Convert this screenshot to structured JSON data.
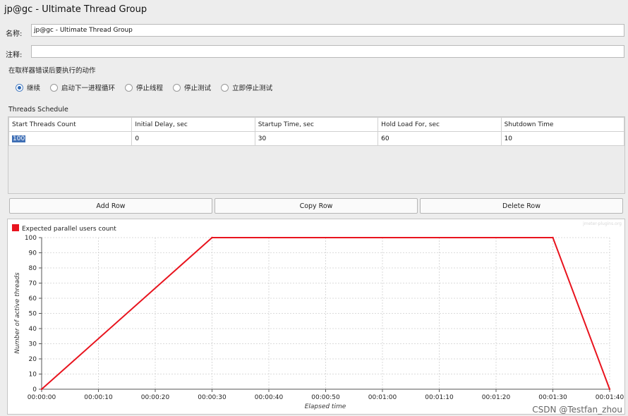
{
  "window": {
    "title": "jp@gc - Ultimate Thread Group"
  },
  "name_field": {
    "label": "名称:",
    "value": "jp@gc - Ultimate Thread Group"
  },
  "comment_field": {
    "label": "注释:",
    "value": ""
  },
  "error_action": {
    "label": "在取样器错误后要执行的动作",
    "options": [
      "继续",
      "启动下一进程循环",
      "停止线程",
      "停止测试",
      "立即停止测试"
    ],
    "selected_index": 0
  },
  "schedule": {
    "label": "Threads Schedule",
    "columns": [
      "Start Threads Count",
      "Initial Delay, sec",
      "Startup Time, sec",
      "Hold Load For, sec",
      "Shutdown Time"
    ],
    "rows": [
      [
        "100",
        "0",
        "30",
        "60",
        "10"
      ]
    ]
  },
  "buttons": {
    "add_row": "Add Row",
    "copy_row": "Copy Row",
    "delete_row": "Delete Row"
  },
  "chart_data": {
    "type": "line",
    "legend": "Expected parallel users count",
    "xlabel": "Elapsed time",
    "ylabel": "Number of active threads",
    "x_ticks": [
      "00:00:00",
      "00:00:10",
      "00:00:20",
      "00:00:30",
      "00:00:40",
      "00:00:50",
      "00:01:00",
      "00:01:10",
      "00:01:20",
      "00:01:30",
      "00:01:40"
    ],
    "y_ticks": [
      0,
      10,
      20,
      30,
      40,
      50,
      60,
      70,
      80,
      90,
      100
    ],
    "xlim": [
      0,
      100
    ],
    "ylim": [
      0,
      100
    ],
    "series": [
      {
        "name": "Expected parallel users count",
        "color": "#e8141e",
        "points": [
          [
            0,
            0
          ],
          [
            30,
            100
          ],
          [
            90,
            100
          ],
          [
            100,
            0
          ]
        ]
      }
    ],
    "grid": true,
    "faint_label": "jmeter-plugins.org"
  },
  "watermark": "CSDN @Testfan_zhou",
  "colors": {
    "series": "#e8141e",
    "selection": "#3f6fb5",
    "radio": "#2d68b5"
  }
}
